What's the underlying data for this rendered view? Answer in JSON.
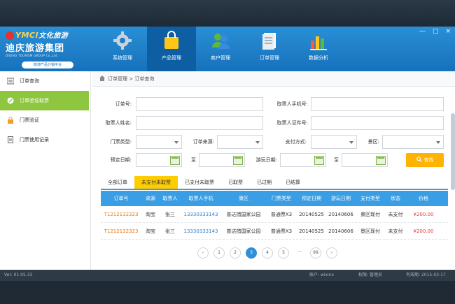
{
  "window": {
    "controls": [
      "—",
      "□",
      "×"
    ]
  },
  "logo": {
    "en": "YMCI",
    "cn_small": "文化旅游",
    "name": "迪庆旅游集团",
    "sub": "DIQING TOURISM GROUP Co.,Ltd.",
    "tag": "旅游产品分销平台"
  },
  "nav": {
    "items": [
      {
        "label": "系统管理",
        "icon": "gear-icon"
      },
      {
        "label": "产品管理",
        "icon": "shopping-bag-icon"
      },
      {
        "label": "商户管理",
        "icon": "users-icon"
      },
      {
        "label": "订单管理",
        "icon": "document-icon"
      },
      {
        "label": "数据分析",
        "icon": "bar-chart-icon"
      }
    ],
    "active": 1
  },
  "sidebar": {
    "items": [
      {
        "label": "订单查询",
        "icon": "list-icon"
      },
      {
        "label": "订单验证取票",
        "icon": "edit-icon"
      },
      {
        "label": "门票验证",
        "icon": "lock-icon"
      },
      {
        "label": "门票使用记录",
        "icon": "file-icon"
      }
    ],
    "active": 1
  },
  "breadcrumb": {
    "home_icon": "home-icon",
    "path": "订单管理 > 订单查询"
  },
  "form": {
    "order_no": "订单号:",
    "taker_phone": "取票人手机号:",
    "taker_name": "取票人姓名:",
    "taker_id": "取票人证件号:",
    "ticket_type": "门票类型:",
    "order_source": "订单来源:",
    "pay_method": "支付方式:",
    "scenic": "景区:",
    "book_date": "预定日期:",
    "to1": "至",
    "visit_date": "游玩日期:",
    "to2": "至",
    "search_label": "查找",
    "search_icon": "search-icon"
  },
  "tabs": [
    "全部订单",
    "未支付未取票",
    "已支付未取票",
    "已取票",
    "已过期",
    "已结算"
  ],
  "active_tab": 1,
  "table": {
    "headers": [
      "订单号",
      "来源",
      "取票人",
      "取票人手机",
      "景区",
      "门票类型",
      "预定日期",
      "游玩日期",
      "支付类型",
      "状态",
      "价格"
    ],
    "rows": [
      [
        "T1212132323",
        "淘宝",
        "张三",
        "13330333143",
        "普达措国家公园",
        "普通票X3",
        "20140525",
        "20140606",
        "景区现付",
        "未支付",
        "¥200.00"
      ],
      [
        "T1212132323",
        "淘宝",
        "张三",
        "13330333143",
        "普达措国家公园",
        "普通票X3",
        "20140525",
        "20140606",
        "景区现付",
        "未支付",
        "¥200.00"
      ]
    ]
  },
  "pager": {
    "prev": "‹",
    "pages": [
      "1",
      "2",
      "3",
      "4",
      "5",
      "···",
      "99"
    ],
    "active": 2,
    "next": "›"
  },
  "status": {
    "version": "Ver: 01.05.33",
    "account": "账户: wixinx",
    "role": "权限: 管理员",
    "expire": "有效期: 2015-03-17"
  },
  "colors": {
    "header": "#1f7cc6",
    "accent": "#3a9ee4",
    "sidebar_active": "#8ec63f",
    "search": "#ffb300",
    "order_link": "#e8760f",
    "phone_link": "#2a7fd0",
    "price": "#e53935"
  }
}
